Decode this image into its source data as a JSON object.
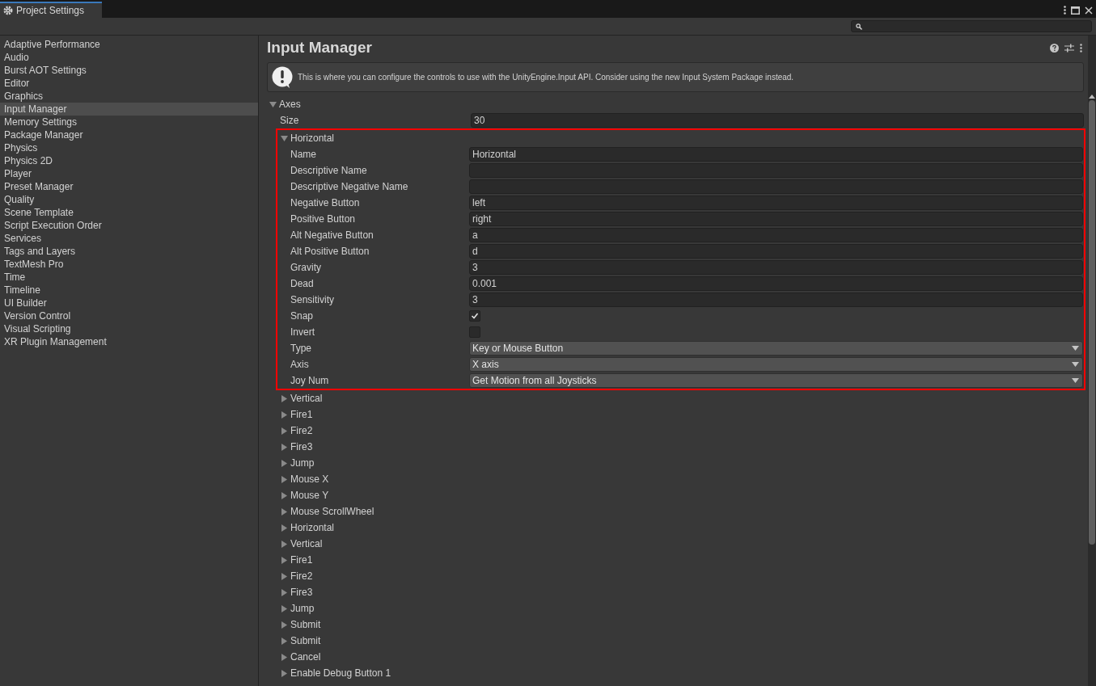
{
  "window": {
    "tab": "Project Settings"
  },
  "sidebar": {
    "items": [
      {
        "label": "Adaptive Performance",
        "selected": false
      },
      {
        "label": "Audio",
        "selected": false
      },
      {
        "label": "Burst AOT Settings",
        "selected": false
      },
      {
        "label": "Editor",
        "selected": false
      },
      {
        "label": "Graphics",
        "selected": false
      },
      {
        "label": "Input Manager",
        "selected": true
      },
      {
        "label": "Memory Settings",
        "selected": false
      },
      {
        "label": "Package Manager",
        "selected": false
      },
      {
        "label": "Physics",
        "selected": false
      },
      {
        "label": "Physics 2D",
        "selected": false
      },
      {
        "label": "Player",
        "selected": false
      },
      {
        "label": "Preset Manager",
        "selected": false
      },
      {
        "label": "Quality",
        "selected": false
      },
      {
        "label": "Scene Template",
        "selected": false
      },
      {
        "label": "Script Execution Order",
        "selected": false
      },
      {
        "label": "Services",
        "selected": false
      },
      {
        "label": "Tags and Layers",
        "selected": false
      },
      {
        "label": "TextMesh Pro",
        "selected": false
      },
      {
        "label": "Time",
        "selected": false
      },
      {
        "label": "Timeline",
        "selected": false
      },
      {
        "label": "UI Builder",
        "selected": false
      },
      {
        "label": "Version Control",
        "selected": false
      },
      {
        "label": "Visual Scripting",
        "selected": false
      },
      {
        "label": "XR Plugin Management",
        "selected": false
      }
    ]
  },
  "main": {
    "title": "Input Manager",
    "info": "This is where you can configure the controls to use with the UnityEngine.Input API. Consider using the new Input System Package instead.",
    "axes": {
      "label": "Axes",
      "expanded": true,
      "size_label": "Size",
      "size": "30",
      "items": [
        {
          "label": "Horizontal",
          "expanded": true,
          "highlighted": true,
          "fields": [
            {
              "kind": "text",
              "label": "Name",
              "value": "Horizontal"
            },
            {
              "kind": "text",
              "label": "Descriptive Name"
            },
            {
              "kind": "text",
              "label": "Descriptive Negative Name"
            },
            {
              "kind": "text",
              "label": "Negative Button",
              "value": "left"
            },
            {
              "kind": "text",
              "label": "Positive Button",
              "value": "right"
            },
            {
              "kind": "text",
              "label": "Alt Negative Button",
              "value": "a"
            },
            {
              "kind": "text",
              "label": "Alt Positive Button",
              "value": "d"
            },
            {
              "kind": "text",
              "label": "Gravity",
              "value": "3"
            },
            {
              "kind": "text",
              "label": "Dead",
              "value": "0.001"
            },
            {
              "kind": "text",
              "label": "Sensitivity",
              "value": "3"
            },
            {
              "kind": "checkbox",
              "label": "Snap",
              "checked": true
            },
            {
              "kind": "checkbox",
              "label": "Invert",
              "checked": false
            },
            {
              "kind": "dropdown",
              "label": "Type",
              "value": "Key or Mouse Button"
            },
            {
              "kind": "dropdown",
              "label": "Axis",
              "value": "X axis"
            },
            {
              "kind": "dropdown",
              "label": "Joy Num",
              "value": "Get Motion from all Joysticks"
            }
          ]
        },
        {
          "label": "Vertical",
          "expanded": false
        },
        {
          "label": "Fire1",
          "expanded": false
        },
        {
          "label": "Fire2",
          "expanded": false
        },
        {
          "label": "Fire3",
          "expanded": false
        },
        {
          "label": "Jump",
          "expanded": false
        },
        {
          "label": "Mouse X",
          "expanded": false
        },
        {
          "label": "Mouse Y",
          "expanded": false
        },
        {
          "label": "Mouse ScrollWheel",
          "expanded": false
        },
        {
          "label": "Horizontal",
          "expanded": false
        },
        {
          "label": "Vertical",
          "expanded": false
        },
        {
          "label": "Fire1",
          "expanded": false
        },
        {
          "label": "Fire2",
          "expanded": false
        },
        {
          "label": "Fire3",
          "expanded": false
        },
        {
          "label": "Jump",
          "expanded": false
        },
        {
          "label": "Submit",
          "expanded": false
        },
        {
          "label": "Submit",
          "expanded": false
        },
        {
          "label": "Cancel",
          "expanded": false
        },
        {
          "label": "Enable Debug Button 1",
          "expanded": false
        }
      ]
    }
  }
}
